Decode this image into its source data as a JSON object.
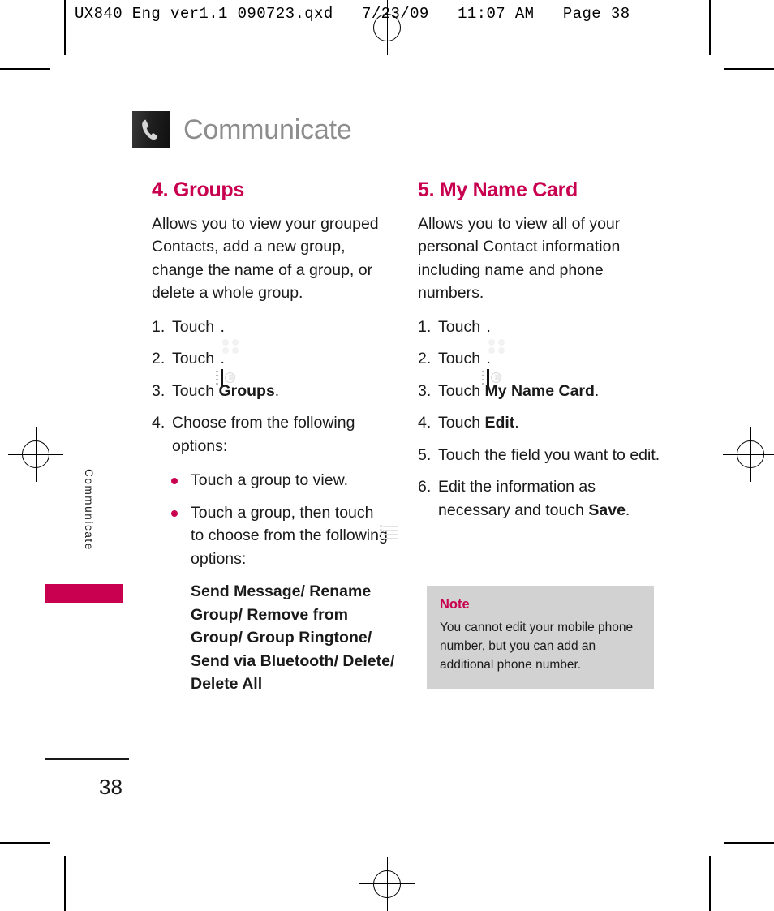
{
  "slug": "UX840_Eng_ver1.1_090723.qxd   7/23/09   11:07 AM   Page 38",
  "header": {
    "title": "Communicate",
    "icon": "phone-handset-icon"
  },
  "side_tab": {
    "label": "Communicate"
  },
  "sections": [
    {
      "title": "4. Groups",
      "intro": "Allows you to view your grouped Contacts, add a new group, change the name of a group, or delete a whole group.",
      "steps": [
        {
          "num": "1.",
          "pre": "Touch ",
          "icon": "grid-menu-icon",
          "post": "."
        },
        {
          "num": "2.",
          "pre": "Touch ",
          "icon": "contacts-book-icon",
          "post": "."
        },
        {
          "num": "3.",
          "pre": "Touch ",
          "bold": "Groups",
          "post": "."
        },
        {
          "num": "4.",
          "pre": "Choose from the following options:"
        }
      ],
      "bullets": [
        {
          "text": "Touch a group to view."
        },
        {
          "pre": "Touch a group, then touch ",
          "icon": "list-menu-icon",
          "post": " to choose from the following options:"
        }
      ],
      "options": "Send Message/ Rename Group/ Remove from Group/ Group Ringtone/ Send via Bluetooth/ Delete/ Delete All"
    },
    {
      "title": "5. My Name Card",
      "intro": "Allows you to view all of your personal Contact information including name and phone numbers.",
      "steps": [
        {
          "num": "1.",
          "pre": "Touch ",
          "icon": "grid-menu-icon",
          "post": "."
        },
        {
          "num": "2.",
          "pre": "Touch ",
          "icon": "contacts-book-icon",
          "post": "."
        },
        {
          "num": "3.",
          "pre": "Touch ",
          "bold": "My Name Card",
          "post": "."
        },
        {
          "num": "4.",
          "pre": "Touch ",
          "bold": "Edit",
          "post": "."
        },
        {
          "num": "5.",
          "pre": "Touch the field you want to edit."
        },
        {
          "num": "6.",
          "pre": "Edit the information as necessary and touch ",
          "bold": "Save",
          "post": "."
        }
      ],
      "note": {
        "title": "Note",
        "body": "You cannot edit your mobile phone number, but you can add an additional phone number."
      }
    }
  ],
  "footer": {
    "page_number": "38"
  },
  "colors": {
    "accent": "#c8004f",
    "header_gray": "#8d8d8d",
    "note_bg": "#d2d2d2",
    "text": "#1a1a1a"
  }
}
